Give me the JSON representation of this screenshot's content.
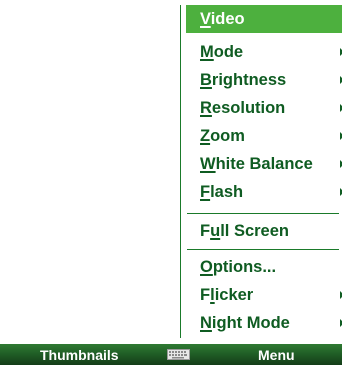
{
  "menu": {
    "items": [
      {
        "pre": "",
        "ul": "V",
        "post": "ideo",
        "submenu": false,
        "selected": true
      },
      {
        "pre": "",
        "ul": "M",
        "post": "ode",
        "submenu": true,
        "selected": false
      },
      {
        "pre": "",
        "ul": "B",
        "post": "rightness",
        "submenu": true,
        "selected": false
      },
      {
        "pre": "",
        "ul": "R",
        "post": "esolution",
        "submenu": true,
        "selected": false
      },
      {
        "pre": "",
        "ul": "Z",
        "post": "oom",
        "submenu": true,
        "selected": false
      },
      {
        "pre": "",
        "ul": "W",
        "post": "hite Balance",
        "submenu": true,
        "selected": false
      },
      {
        "pre": "",
        "ul": "F",
        "post": "lash",
        "submenu": true,
        "selected": false
      },
      {
        "pre": "F",
        "ul": "u",
        "post": "ll Screen",
        "submenu": false,
        "selected": false
      },
      {
        "pre": "",
        "ul": "O",
        "post": "ptions...",
        "submenu": false,
        "selected": false
      },
      {
        "pre": "F",
        "ul": "l",
        "post": "icker",
        "submenu": true,
        "selected": false
      },
      {
        "pre": "",
        "ul": "N",
        "post": "ight Mode",
        "submenu": true,
        "selected": false
      }
    ]
  },
  "softkeys": {
    "left_label": "Thumbnails",
    "right_label": "Menu",
    "center_icon": "keyboard-icon"
  },
  "colors": {
    "accent": "#4db03e",
    "menu_text": "#0f5c22",
    "bar_dark": "#1f5c25"
  }
}
